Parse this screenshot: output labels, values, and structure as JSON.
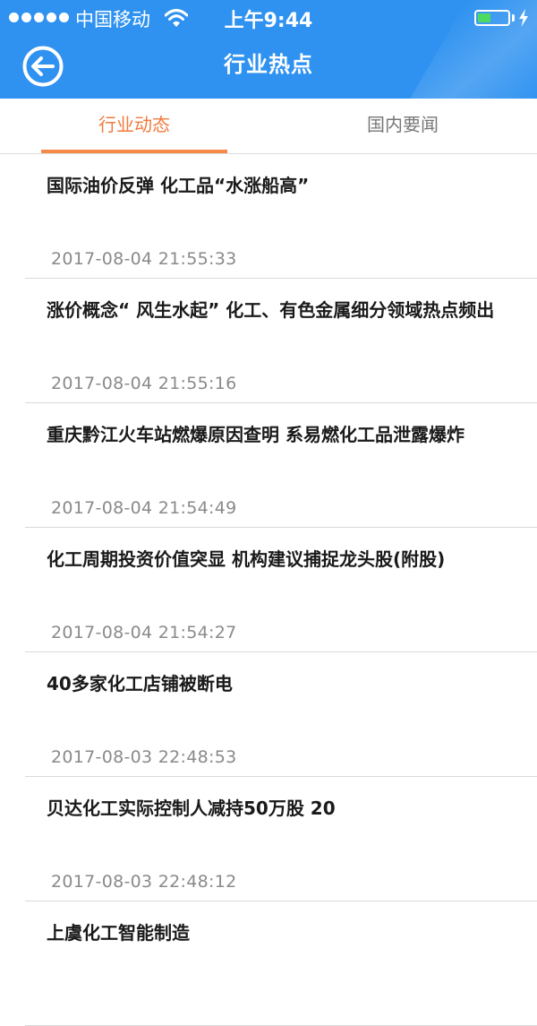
{
  "status_bar": {
    "carrier": "中国移动",
    "time": "上午9:44",
    "battery_level": 0.45,
    "battery_color": "#4cd964",
    "wifi_icon": "wifi-icon",
    "charging_icon": "charging-bolt-icon"
  },
  "header": {
    "title": "行业热点",
    "back_icon": "back-arrow-icon",
    "color": "#2f92f0"
  },
  "tabs": [
    {
      "label": "行业动态",
      "active": true
    },
    {
      "label": "国内要闻",
      "active": false
    }
  ],
  "accent_color": "#f07a3c",
  "news": [
    {
      "title": "国际油价反弹 化工品“水涨船高”",
      "time": "2017-08-04 21:55:33"
    },
    {
      "title": "涨价概念“ 风生水起” 化工、有色金属细分领域热点频出",
      "time": "2017-08-04 21:55:16"
    },
    {
      "title": "重庆黔江火车站燃爆原因查明 系易燃化工品泄露爆炸",
      "time": "2017-08-04 21:54:49"
    },
    {
      "title": "化工周期投资价值突显 机构建议捕捉龙头股(附股)",
      "time": "2017-08-04 21:54:27"
    },
    {
      "title": "40多家化工店铺被断电",
      "time": "2017-08-03 22:48:53"
    },
    {
      "title": "贝达化工实际控制人减持50万股 20",
      "time": "2017-08-03 22:48:12"
    },
    {
      "title": "上虞化工智能制造",
      "time": ""
    }
  ]
}
